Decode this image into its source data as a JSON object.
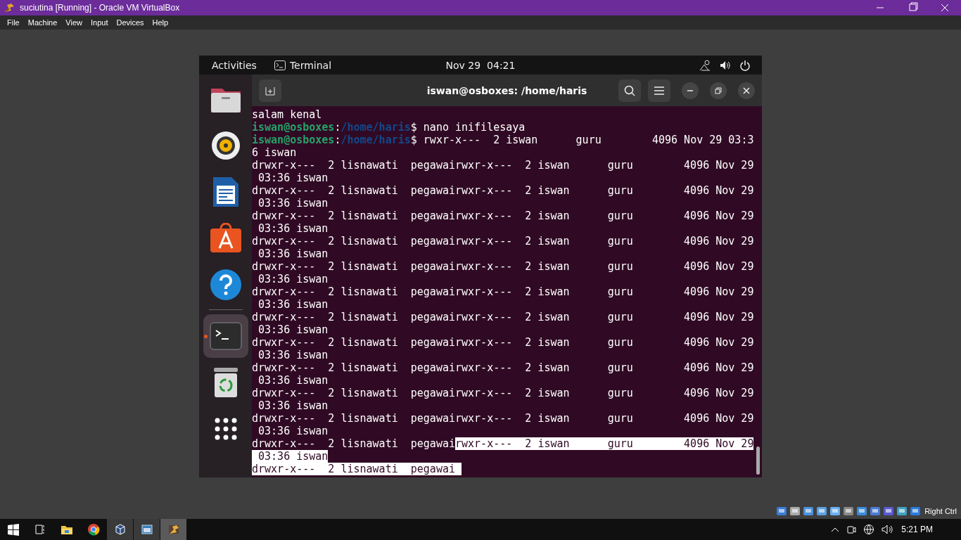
{
  "host_window": {
    "title": "suciutina [Running] - Oracle VM VirtualBox",
    "menu": [
      "File",
      "Machine",
      "View",
      "Input",
      "Devices",
      "Help"
    ]
  },
  "guest": {
    "top_bar": {
      "activities": "Activities",
      "app": "Terminal",
      "clock": "Nov 29  04:21"
    },
    "dock": [
      {
        "kind": "files",
        "active": false
      },
      {
        "kind": "music",
        "active": false
      },
      {
        "kind": "writer",
        "active": false
      },
      {
        "kind": "store",
        "active": false
      },
      {
        "kind": "help",
        "active": false
      },
      {
        "kind": "separator"
      },
      {
        "kind": "terminal",
        "active": true
      },
      {
        "kind": "trash",
        "active": false
      },
      {
        "kind": "apps",
        "active": false
      }
    ],
    "terminal": {
      "title": "iswan@osboxes: /home/haris",
      "lines": [
        [
          {
            "kind": "plain",
            "text": "salam kenal",
            "selected": false
          }
        ],
        [
          {
            "kind": "user",
            "text": "iswan@osboxes",
            "selected": false
          },
          {
            "kind": "plain",
            "text": ":",
            "selected": false
          },
          {
            "kind": "path",
            "text": "/home/haris",
            "selected": false
          },
          {
            "kind": "plain",
            "text": "$ nano inifilesaya",
            "selected": false
          }
        ],
        [
          {
            "kind": "user",
            "text": "iswan@osboxes",
            "selected": false
          },
          {
            "kind": "plain",
            "text": ":",
            "selected": false
          },
          {
            "kind": "path",
            "text": "/home/haris",
            "selected": false
          },
          {
            "kind": "plain",
            "text": "$ rwxr-x---  2 iswan      guru        4096 Nov 29 03:3",
            "selected": false
          }
        ],
        [
          {
            "kind": "plain",
            "text": "6 iswan",
            "selected": false
          }
        ],
        [
          {
            "kind": "plain",
            "text": "drwxr-x---  2 lisnawati  pegawairwxr-x---  2 iswan      guru        4096 Nov 29",
            "selected": false
          }
        ],
        [
          {
            "kind": "plain",
            "text": " 03:36 iswan",
            "selected": false
          }
        ],
        [
          {
            "kind": "plain",
            "text": "drwxr-x---  2 lisnawati  pegawairwxr-x---  2 iswan      guru        4096 Nov 29",
            "selected": false
          }
        ],
        [
          {
            "kind": "plain",
            "text": " 03:36 iswan",
            "selected": false
          }
        ],
        [
          {
            "kind": "plain",
            "text": "drwxr-x---  2 lisnawati  pegawairwxr-x---  2 iswan      guru        4096 Nov 29",
            "selected": false
          }
        ],
        [
          {
            "kind": "plain",
            "text": " 03:36 iswan",
            "selected": false
          }
        ],
        [
          {
            "kind": "plain",
            "text": "drwxr-x---  2 lisnawati  pegawairwxr-x---  2 iswan      guru        4096 Nov 29",
            "selected": false
          }
        ],
        [
          {
            "kind": "plain",
            "text": " 03:36 iswan",
            "selected": false
          }
        ],
        [
          {
            "kind": "plain",
            "text": "drwxr-x---  2 lisnawati  pegawairwxr-x---  2 iswan      guru        4096 Nov 29",
            "selected": false
          }
        ],
        [
          {
            "kind": "plain",
            "text": " 03:36 iswan",
            "selected": false
          }
        ],
        [
          {
            "kind": "plain",
            "text": "drwxr-x---  2 lisnawati  pegawairwxr-x---  2 iswan      guru        4096 Nov 29",
            "selected": false
          }
        ],
        [
          {
            "kind": "plain",
            "text": " 03:36 iswan",
            "selected": false
          }
        ],
        [
          {
            "kind": "plain",
            "text": "drwxr-x---  2 lisnawati  pegawairwxr-x---  2 iswan      guru        4096 Nov 29",
            "selected": false
          }
        ],
        [
          {
            "kind": "plain",
            "text": " 03:36 iswan",
            "selected": false
          }
        ],
        [
          {
            "kind": "plain",
            "text": "drwxr-x---  2 lisnawati  pegawairwxr-x---  2 iswan      guru        4096 Nov 29",
            "selected": false
          }
        ],
        [
          {
            "kind": "plain",
            "text": " 03:36 iswan",
            "selected": false
          }
        ],
        [
          {
            "kind": "plain",
            "text": "drwxr-x---  2 lisnawati  pegawairwxr-x---  2 iswan      guru        4096 Nov 29",
            "selected": false
          }
        ],
        [
          {
            "kind": "plain",
            "text": " 03:36 iswan",
            "selected": false
          }
        ],
        [
          {
            "kind": "plain",
            "text": "drwxr-x---  2 lisnawati  pegawairwxr-x---  2 iswan      guru        4096 Nov 29",
            "selected": false
          }
        ],
        [
          {
            "kind": "plain",
            "text": " 03:36 iswan",
            "selected": false
          }
        ],
        [
          {
            "kind": "plain",
            "text": "drwxr-x---  2 lisnawati  pegawairwxr-x---  2 iswan      guru        4096 Nov 29",
            "selected": false
          }
        ],
        [
          {
            "kind": "plain",
            "text": " 03:36 iswan",
            "selected": false
          }
        ],
        [
          {
            "kind": "plain",
            "text": "drwxr-x---  2 lisnawati  pegawai",
            "selected": false
          },
          {
            "kind": "plain",
            "text": "rwxr-x---  2 iswan      guru        4096 Nov 29",
            "selected": true
          }
        ],
        [
          {
            "kind": "plain",
            "text": " 03:36 iswan",
            "selected": true
          }
        ],
        [
          {
            "kind": "plain",
            "text": "drwxr-x---  2 lisnawati  pegawai ",
            "selected": true
          }
        ]
      ]
    }
  },
  "status_bar": {
    "host_key": "Right Ctrl"
  },
  "taskbar": {
    "apps": [
      {
        "kind": "start"
      },
      {
        "kind": "taskview"
      },
      {
        "kind": "folder",
        "running": false,
        "selected": false
      },
      {
        "kind": "browser",
        "running": false,
        "selected": false
      },
      {
        "kind": "cube",
        "running": true,
        "selected": false
      },
      {
        "kind": "window",
        "running": true,
        "selected": false
      },
      {
        "kind": "vm",
        "running": true,
        "selected": true
      }
    ],
    "clock": "5:21 PM"
  }
}
